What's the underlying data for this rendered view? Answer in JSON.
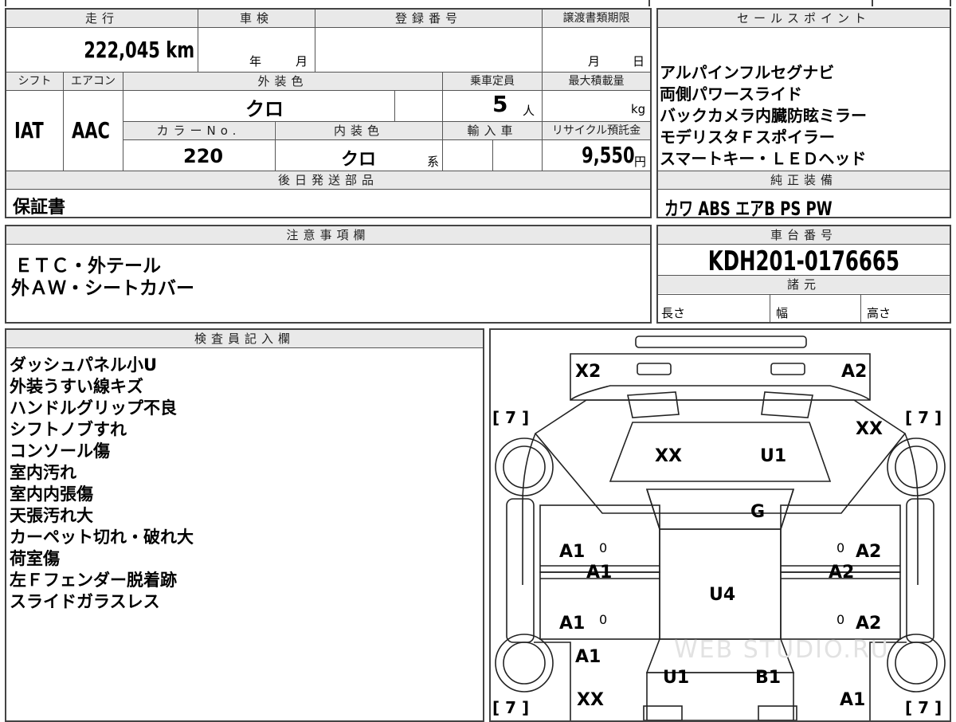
{
  "header": {
    "mileage_label": "走行",
    "shaken_label": "車検",
    "reg_no_label": "登録番号",
    "transfer_deadline_label": "譲渡書類期限",
    "sales_points_label": "セールスポイント"
  },
  "mileage": "222,045 km",
  "shaken": {
    "year_unit": "年",
    "month_unit": "月"
  },
  "transfer_deadline": {
    "month_unit": "月",
    "day_unit": "日"
  },
  "row2_labels": {
    "shift": "シフト",
    "aircon": "エアコン",
    "exterior_color": "外装色",
    "capacity": "乗車定員",
    "max_load": "最大積載量"
  },
  "shift": "IAT",
  "aircon": "AAC",
  "exterior_color": "クロ",
  "capacity": {
    "value": "5",
    "unit": "人"
  },
  "max_load": {
    "unit": "kg"
  },
  "row3_labels": {
    "color_no": "カラーNo.",
    "interior_color": "内装色",
    "import": "輸入車",
    "recycle_fee": "リサイクル預託金"
  },
  "color_no": "220",
  "interior_color": {
    "value": "クロ",
    "suffix": "系"
  },
  "recycle_fee": {
    "value": "9,550",
    "unit": "円"
  },
  "sales_points": [
    "アルパインフルセグナビ",
    "両側パワースライド",
    "バックカメラ内臓防眩ミラー",
    "モデリスタＦスポイラー",
    "スマートキー・ＬＥＤヘッド"
  ],
  "later_parts": {
    "label": "後日発送部品",
    "value": "保証書"
  },
  "genuine_equipment": {
    "label": "純正装備",
    "value": "カワ ABS エアB PS PW"
  },
  "notes": {
    "label": "注意事項欄",
    "lines": [
      "ＥＴＣ・外テール",
      "外ＡＷ・シートカバー"
    ]
  },
  "chassis_number": {
    "label": "車台番号",
    "value": "KDH201-0176665"
  },
  "specs": {
    "label": "諸元",
    "length": "長さ",
    "width": "幅",
    "height": "高さ"
  },
  "inspector": {
    "label": "検査員記入欄",
    "lines": [
      "ダッシュパネル小U",
      "外装うすい線キズ",
      "ハンドルグリップ不良",
      "シフトノブすれ",
      "コンソール傷",
      "室内汚れ",
      "室内内張傷",
      "天張汚れ大",
      "カーペット切れ・破れ大",
      "荷室傷",
      "左Ｆフェンダー脱着跡",
      "スライドガラスレス"
    ]
  },
  "diagram": {
    "tire_tread": [
      "[ 7 ]",
      "[ 7 ]",
      "[ 7 ]",
      "[ 7 ]"
    ],
    "marks": {
      "front_bumper_left": "X2",
      "front_bumper_right": "A2",
      "right_front_fender": "XX",
      "windshield_left": "XX",
      "windshield_right": "U1",
      "roof_front": "G",
      "left_front_door": "A1",
      "left_front_door_small": "0",
      "left_sill_front": "A1",
      "right_front_door": "A2",
      "right_front_door_small": "0",
      "right_sill_front": "A2",
      "roof": "U4",
      "left_rear_door": "A1",
      "left_rear_door_small": "0",
      "right_rear_door": "A2",
      "right_rear_door_small": "0",
      "left_rear_quarter": "A1",
      "rear_glass_left": "U1",
      "rear_glass_right": "B1",
      "left_rear_corner": "XX",
      "right_rear_corner": "A1"
    },
    "watermark": "WEB STUDIO.RU"
  }
}
